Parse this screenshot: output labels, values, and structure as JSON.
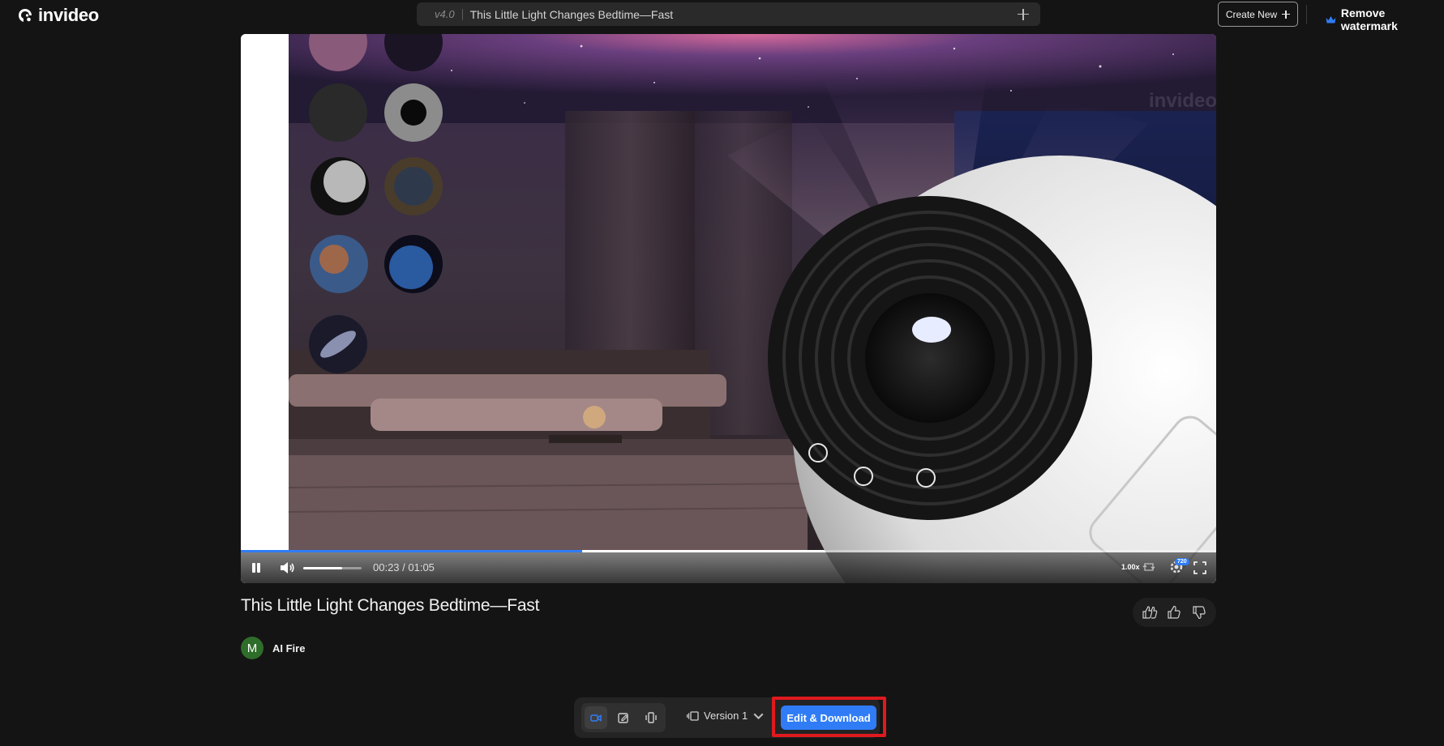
{
  "header": {
    "brand": "invideo",
    "version_tag": "v4.0",
    "project_title": "This Little Light Changes Bedtime—Fast",
    "create_new_label": "Create New",
    "remove_watermark_label": "Remove watermark",
    "icons": [
      "logo-icon",
      "plus-icon",
      "crown-icon"
    ]
  },
  "player": {
    "current_time": "00:23",
    "duration": "01:05",
    "time_display": "00:23 / 01:05",
    "progress_fraction": 0.35,
    "volume_fraction": 0.67,
    "playback_speed": "1.00x",
    "quality": "720",
    "watermark_text": "invideo",
    "state": "playing"
  },
  "video_info": {
    "title": "This Little Light Changes Bedtime—Fast",
    "author_initial": "M",
    "author_name": "AI Fire"
  },
  "toolbar": {
    "version_label": "Version 1",
    "edit_download_label": "Edit & Download"
  },
  "colors": {
    "accent": "#2f7cf6",
    "background": "#141414",
    "highlight": "#e0191e",
    "avatar": "#2f6d2a"
  }
}
